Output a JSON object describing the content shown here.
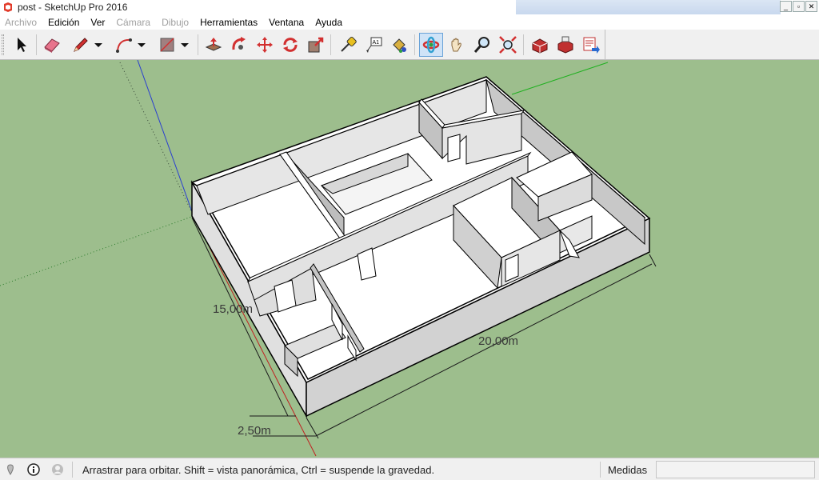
{
  "window": {
    "title": "post - SketchUp Pro 2016",
    "minimize": "_",
    "restore": "▫",
    "close": "✕"
  },
  "menu": [
    {
      "label": "Archivo",
      "disabled": true
    },
    {
      "label": "Edición",
      "disabled": false
    },
    {
      "label": "Ver",
      "disabled": false
    },
    {
      "label": "Cámara",
      "disabled": true
    },
    {
      "label": "Dibujo",
      "disabled": true
    },
    {
      "label": "Herramientas",
      "disabled": false
    },
    {
      "label": "Ventana",
      "disabled": false
    },
    {
      "label": "Ayuda",
      "disabled": false
    }
  ],
  "toolbar": {
    "tools": [
      {
        "name": "select-tool",
        "icon": "arrow"
      },
      {
        "name": "eraser-tool",
        "icon": "eraser"
      },
      {
        "name": "pencil-tool",
        "icon": "pencil"
      },
      {
        "name": "arc-tool",
        "icon": "arc"
      },
      {
        "name": "rectangle-tool",
        "icon": "rectangle"
      },
      {
        "name": "push-pull-tool",
        "icon": "push-pull"
      },
      {
        "name": "follow-me-tool",
        "icon": "follow-me"
      },
      {
        "name": "move-tool",
        "icon": "move"
      },
      {
        "name": "rotate-tool",
        "icon": "rotate"
      },
      {
        "name": "scale-tool",
        "icon": "scale"
      },
      {
        "name": "tape-measure-tool",
        "icon": "tape"
      },
      {
        "name": "text-tool",
        "icon": "text"
      },
      {
        "name": "paint-bucket-tool",
        "icon": "paint"
      },
      {
        "name": "orbit-tool",
        "icon": "orbit",
        "active": true
      },
      {
        "name": "pan-tool",
        "icon": "hand"
      },
      {
        "name": "zoom-tool",
        "icon": "zoom"
      },
      {
        "name": "zoom-extents-tool",
        "icon": "zoom-extents"
      },
      {
        "name": "warehouse-tool",
        "icon": "warehouse"
      },
      {
        "name": "extension-warehouse-tool",
        "icon": "extension"
      },
      {
        "name": "send-to-layout-tool",
        "icon": "layout"
      }
    ],
    "text_icon_label": "A1"
  },
  "model": {
    "dimension_width": "15,00m",
    "dimension_length": "20,00m",
    "dimension_offset": "2,50m"
  },
  "status": {
    "hint": "Arrastrar para orbitar. Shift = vista panorámica, Ctrl = suspende la gravedad.",
    "measure_label": "Medidas",
    "measure_value": ""
  },
  "colors": {
    "ground": "#9dbe8d",
    "wall_top": "#ffffff",
    "wall_side": "#d6d6d6",
    "active_tool": "#cfe3f7"
  }
}
